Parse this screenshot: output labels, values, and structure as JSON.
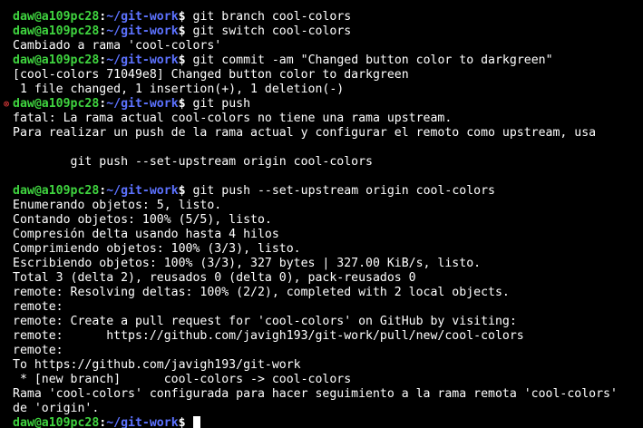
{
  "terminal": {
    "prompt": {
      "user_host": "daw@a109pc28",
      "separator": ":",
      "path": "~/git-work",
      "symbol": "$"
    },
    "lines": [
      {
        "type": "output",
        "text": "                                          "
      },
      {
        "type": "prompt",
        "icon": "",
        "command": " git branch cool-colors"
      },
      {
        "type": "prompt",
        "icon": "",
        "command": " git switch cool-colors"
      },
      {
        "type": "output",
        "text": "Cambiado a rama 'cool-colors'"
      },
      {
        "type": "prompt",
        "icon": "",
        "command": " git commit -am \"Changed button color to darkgreen\""
      },
      {
        "type": "output",
        "text": "[cool-colors 71049e8] Changed button color to darkgreen"
      },
      {
        "type": "output",
        "text": " 1 file changed, 1 insertion(+), 1 deletion(-)"
      },
      {
        "type": "prompt",
        "icon": "error",
        "command": " git push"
      },
      {
        "type": "output",
        "text": "fatal: La rama actual cool-colors no tiene una rama upstream."
      },
      {
        "type": "output",
        "text": "Para realizar un push de la rama actual y configurar el remoto como upstream, usa"
      },
      {
        "type": "output",
        "text": ""
      },
      {
        "type": "output",
        "text": "        git push --set-upstream origin cool-colors"
      },
      {
        "type": "output",
        "text": ""
      },
      {
        "type": "prompt",
        "icon": "",
        "command": " git push --set-upstream origin cool-colors"
      },
      {
        "type": "output",
        "text": "Enumerando objetos: 5, listo."
      },
      {
        "type": "output",
        "text": "Contando objetos: 100% (5/5), listo."
      },
      {
        "type": "output",
        "text": "Compresión delta usando hasta 4 hilos"
      },
      {
        "type": "output",
        "text": "Comprimiendo objetos: 100% (3/3), listo."
      },
      {
        "type": "output",
        "text": "Escribiendo objetos: 100% (3/3), 327 bytes | 327.00 KiB/s, listo."
      },
      {
        "type": "output",
        "text": "Total 3 (delta 2), reusados 0 (delta 0), pack-reusados 0"
      },
      {
        "type": "output",
        "text": "remote: Resolving deltas: 100% (2/2), completed with 2 local objects."
      },
      {
        "type": "output",
        "text": "remote:"
      },
      {
        "type": "output",
        "text": "remote: Create a pull request for 'cool-colors' on GitHub by visiting:"
      },
      {
        "type": "output",
        "text": "remote:      https://github.com/javigh193/git-work/pull/new/cool-colors"
      },
      {
        "type": "output",
        "text": "remote:"
      },
      {
        "type": "output",
        "text": "To https://github.com/javigh193/git-work"
      },
      {
        "type": "output",
        "text": " * [new branch]      cool-colors -> cool-colors"
      },
      {
        "type": "output",
        "text": "Rama 'cool-colors' configurada para hacer seguimiento a la rama remota 'cool-colors'"
      },
      {
        "type": "output",
        "text": "de 'origin'."
      },
      {
        "type": "prompt",
        "icon": "",
        "command": " ",
        "cursor": true
      }
    ]
  }
}
